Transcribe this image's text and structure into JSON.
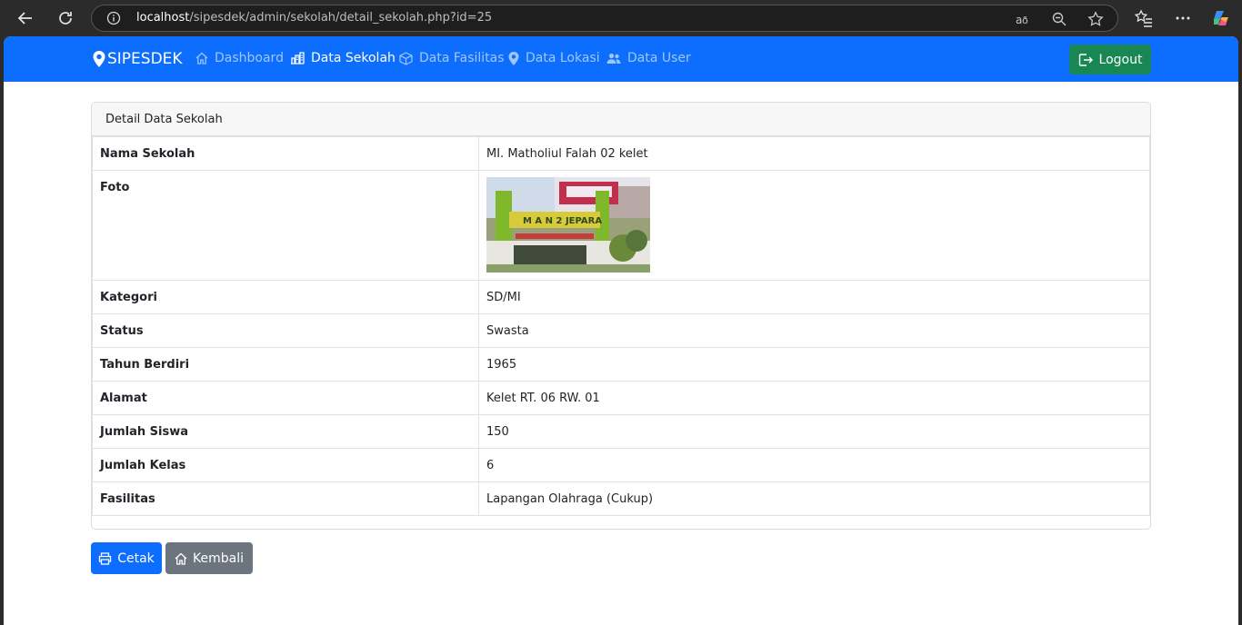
{
  "browser": {
    "url_host": "localhost",
    "url_path": "/sipesdek/admin/sekolah/detail_sekolah.php?id=25"
  },
  "navbar": {
    "brand": "SIPESDEK",
    "items": [
      {
        "label": "Dashboard",
        "icon": "home-icon"
      },
      {
        "label": "Data Sekolah",
        "icon": "building-icon"
      },
      {
        "label": "Data Fasilitas",
        "icon": "box-icon"
      },
      {
        "label": "Data Lokasi",
        "icon": "map-pin-icon"
      },
      {
        "label": "Data User",
        "icon": "users-icon"
      }
    ],
    "active": "Data Sekolah",
    "logout_label": "Logout"
  },
  "card": {
    "header": "Detail Data Sekolah",
    "rows": [
      {
        "label": "Nama Sekolah",
        "value": "MI. Matholiul Falah 02 kelet"
      },
      {
        "label": "Foto",
        "value": ""
      },
      {
        "label": "Kategori",
        "value": "SD/MI"
      },
      {
        "label": "Status",
        "value": "Swasta"
      },
      {
        "label": "Tahun Berdiri",
        "value": "1965"
      },
      {
        "label": "Alamat",
        "value": "Kelet RT. 06 RW. 01"
      },
      {
        "label": "Jumlah Siswa",
        "value": "150"
      },
      {
        "label": "Jumlah Kelas",
        "value": "6"
      },
      {
        "label": "Fasilitas",
        "value": "Lapangan Olahraga (Cukup)"
      }
    ],
    "photo_sign": "M A N 2 JEPARA"
  },
  "buttons": {
    "print_label": "Cetak",
    "back_label": "Kembali"
  },
  "colors": {
    "primary": "#0d6efd",
    "success": "#198754",
    "secondary": "#6c757d"
  }
}
